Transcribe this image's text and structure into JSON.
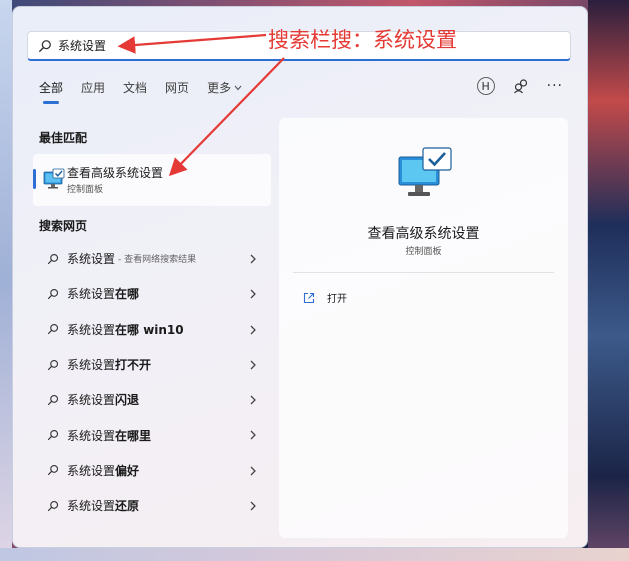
{
  "search": {
    "query": "系统设置"
  },
  "tabs": [
    {
      "label": "全部"
    },
    {
      "label": "应用"
    },
    {
      "label": "文档"
    },
    {
      "label": "网页"
    },
    {
      "label": "更多"
    }
  ],
  "account": {
    "initial": "H"
  },
  "best_match": {
    "section_title": "最佳匹配",
    "title": "查看高级系统设置",
    "subtitle": "控制面板"
  },
  "web": {
    "section_title": "搜索网页",
    "items": [
      {
        "prefix": "系统设置",
        "bold": "",
        "hint": "- 查看网络搜索结果"
      },
      {
        "prefix": "系统设置",
        "bold": "在哪",
        "hint": ""
      },
      {
        "prefix": "系统设置",
        "bold": "在哪 win10",
        "hint": ""
      },
      {
        "prefix": "系统设置",
        "bold": "打不开",
        "hint": ""
      },
      {
        "prefix": "系统设置",
        "bold": "闪退",
        "hint": ""
      },
      {
        "prefix": "系统设置",
        "bold": "在哪里",
        "hint": ""
      },
      {
        "prefix": "系统设置",
        "bold": "偏好",
        "hint": ""
      },
      {
        "prefix": "系统设置",
        "bold": "还原",
        "hint": ""
      }
    ]
  },
  "detail": {
    "title": "查看高级系统设置",
    "subtitle": "控制面板",
    "open_label": "打开"
  },
  "annotation": {
    "text": "搜索栏搜：系统设置",
    "color": "#e53935"
  },
  "colors": {
    "accent": "#2e6fd6",
    "annotation": "#e53935"
  }
}
